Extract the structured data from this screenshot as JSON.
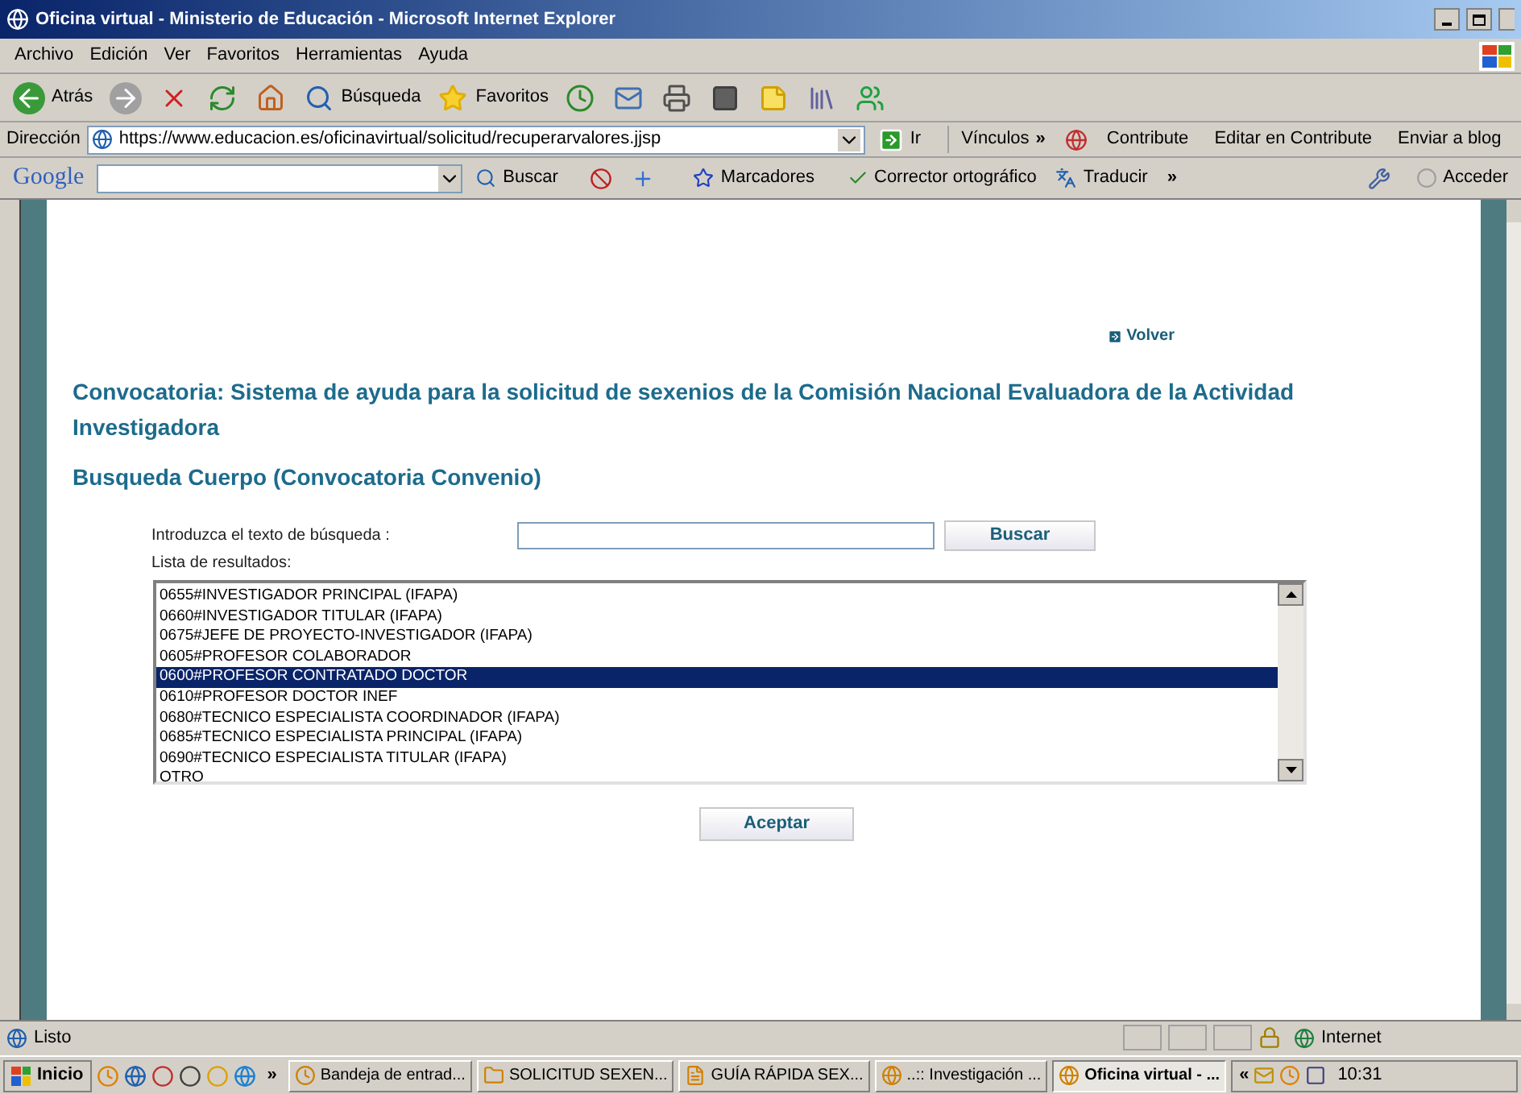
{
  "window": {
    "title": "Oficina virtual - Ministerio de Educación - Microsoft Internet Explorer"
  },
  "menu": [
    "Archivo",
    "Edición",
    "Ver",
    "Favoritos",
    "Herramientas",
    "Ayuda"
  ],
  "toolbar": [
    {
      "kind": "back",
      "label": "Atrás"
    },
    {
      "kind": "forward"
    },
    {
      "kind": "stop"
    },
    {
      "kind": "refresh"
    },
    {
      "kind": "home"
    },
    {
      "kind": "search",
      "label": "Búsqueda"
    },
    {
      "kind": "favorites",
      "label": "Favoritos"
    },
    {
      "kind": "history"
    },
    {
      "kind": "mail"
    },
    {
      "kind": "print"
    },
    {
      "kind": "edit"
    },
    {
      "kind": "note"
    },
    {
      "kind": "research"
    },
    {
      "kind": "messenger"
    }
  ],
  "address": {
    "label": "Dirección",
    "url": "https://www.educacion.es/oficinavirtual/solicitud/recuperarvalores.jjsp",
    "go": "Ir"
  },
  "links": {
    "label": "Vínculos",
    "more": "»",
    "items": [
      "Contribute",
      "Editar en Contribute",
      "Enviar a blog"
    ]
  },
  "google_bar": {
    "logo": "Google",
    "search": "Buscar",
    "bookmarks": "Marcadores",
    "spell": "Corrector ortográfico",
    "translate": "Traducir",
    "more": "»",
    "sign_in": "Acceder"
  },
  "page": {
    "back_link": "Volver",
    "heading": "Convocatoria: Sistema de ayuda para la solicitud de sexenios de la Comisión Nacional Evaluadora de la Actividad Investigadora",
    "subheading": "Busqueda Cuerpo (Convocatoria Convenio)",
    "search_label": "Introduzca el texto de búsqueda :",
    "search_button": "Buscar",
    "results_label": "Lista de resultados:",
    "results": [
      {
        "text": "0655#INVESTIGADOR PRINCIPAL (IFAPA)",
        "selected": false
      },
      {
        "text": "0660#INVESTIGADOR TITULAR (IFAPA)",
        "selected": false
      },
      {
        "text": "0675#JEFE DE PROYECTO-INVESTIGADOR (IFAPA)",
        "selected": false
      },
      {
        "text": "0605#PROFESOR COLABORADOR",
        "selected": false
      },
      {
        "text": "0600#PROFESOR CONTRATADO DOCTOR",
        "selected": true
      },
      {
        "text": "0610#PROFESOR DOCTOR INEF",
        "selected": false
      },
      {
        "text": "0680#TECNICO ESPECIALISTA COORDINADOR (IFAPA)",
        "selected": false
      },
      {
        "text": "0685#TECNICO ESPECIALISTA PRINCIPAL (IFAPA)",
        "selected": false
      },
      {
        "text": "0690#TECNICO ESPECIALISTA TITULAR (IFAPA)",
        "selected": false
      },
      {
        "text": "OTRO",
        "selected": false
      }
    ],
    "accept_button": "Aceptar"
  },
  "status_bar": {
    "text": "Listo",
    "zone": "Internet"
  },
  "taskbar": {
    "start": "Inicio",
    "more": "»",
    "tasks": [
      {
        "label": "Bandeja de entrad...",
        "kind": "mail",
        "selected": false
      },
      {
        "label": "SOLICITUD SEXEN...",
        "kind": "folder",
        "selected": false
      },
      {
        "label": "GUÍA RÁPIDA SEX...",
        "kind": "word",
        "selected": false
      },
      {
        "label": "..:: Investigación ...",
        "kind": "ie",
        "selected": false
      },
      {
        "label": "Oficina virtual - ...",
        "kind": "ie",
        "selected": true
      }
    ],
    "tray_more": "«",
    "clock": "10:31"
  }
}
